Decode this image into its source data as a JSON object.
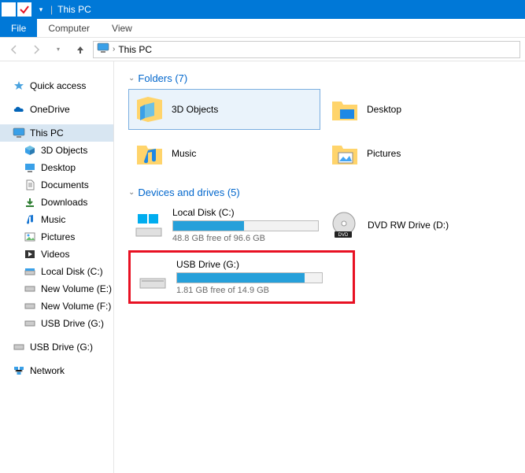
{
  "window": {
    "title": "This PC"
  },
  "ribbon": {
    "file": "File",
    "tabs": [
      "Computer",
      "View"
    ]
  },
  "breadcrumb": {
    "current": "This PC"
  },
  "sidebar": {
    "quick_access": "Quick access",
    "onedrive": "OneDrive",
    "this_pc": "This PC",
    "subs": [
      "3D Objects",
      "Desktop",
      "Documents",
      "Downloads",
      "Music",
      "Pictures",
      "Videos",
      "Local Disk (C:)",
      "New Volume (E:)",
      "New Volume (F:)",
      "USB Drive (G:)"
    ],
    "usb_root": "USB Drive (G:)",
    "network": "Network"
  },
  "sections": {
    "folders": {
      "title": "Folders (7)",
      "items": [
        "3D Objects",
        "Desktop",
        "Music",
        "Pictures"
      ]
    },
    "drives": {
      "title": "Devices and drives (5)",
      "items": [
        {
          "name": "Local Disk (C:)",
          "free": "48.8 GB free of 96.6 GB",
          "pct": 49,
          "type": "os"
        },
        {
          "name": "DVD RW Drive (D:)",
          "free": "",
          "pct": null,
          "type": "dvd"
        },
        {
          "name": "USB Drive (G:)",
          "free": "1.81 GB free of 14.9 GB",
          "pct": 88,
          "type": "usb"
        }
      ]
    }
  }
}
